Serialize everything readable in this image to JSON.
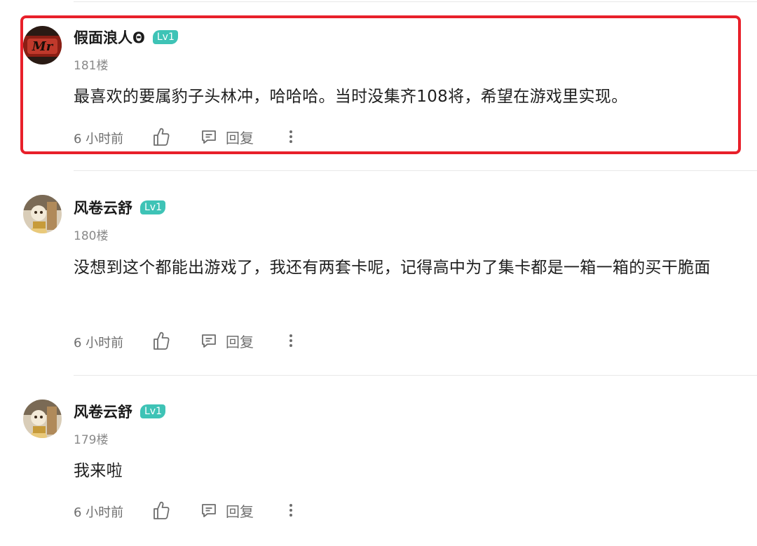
{
  "comments": [
    {
      "username": "假面浪人Θ",
      "level": "Lv1",
      "floor": "181楼",
      "text": "最喜欢的要属豹子头林冲，哈哈哈。当时没集齐108将，希望在游戏里实现。",
      "time": "6 小时前",
      "reply_label": "回复",
      "avatar_icon": "mr-logo-avatar",
      "highlighted": true
    },
    {
      "username": "风卷云舒",
      "level": "Lv1",
      "floor": "180楼",
      "text": "没想到这个都能出游戏了，我还有两套卡呢，记得高中为了集卡都是一箱一箱的买干脆面",
      "time": "6 小时前",
      "reply_label": "回复",
      "avatar_icon": "cartoon-avatar",
      "highlighted": false
    },
    {
      "username": "风卷云舒",
      "level": "Lv1",
      "floor": "179楼",
      "text": "我来啦",
      "time": "6 小时前",
      "reply_label": "回复",
      "avatar_icon": "cartoon-avatar",
      "highlighted": false
    }
  ],
  "colors": {
    "highlight_border": "#e8202a",
    "level_badge": "#3ec3b6",
    "meta_text": "#8a8a8a",
    "divider": "#e8e8e8"
  },
  "avatar_logo_text": "Mr"
}
